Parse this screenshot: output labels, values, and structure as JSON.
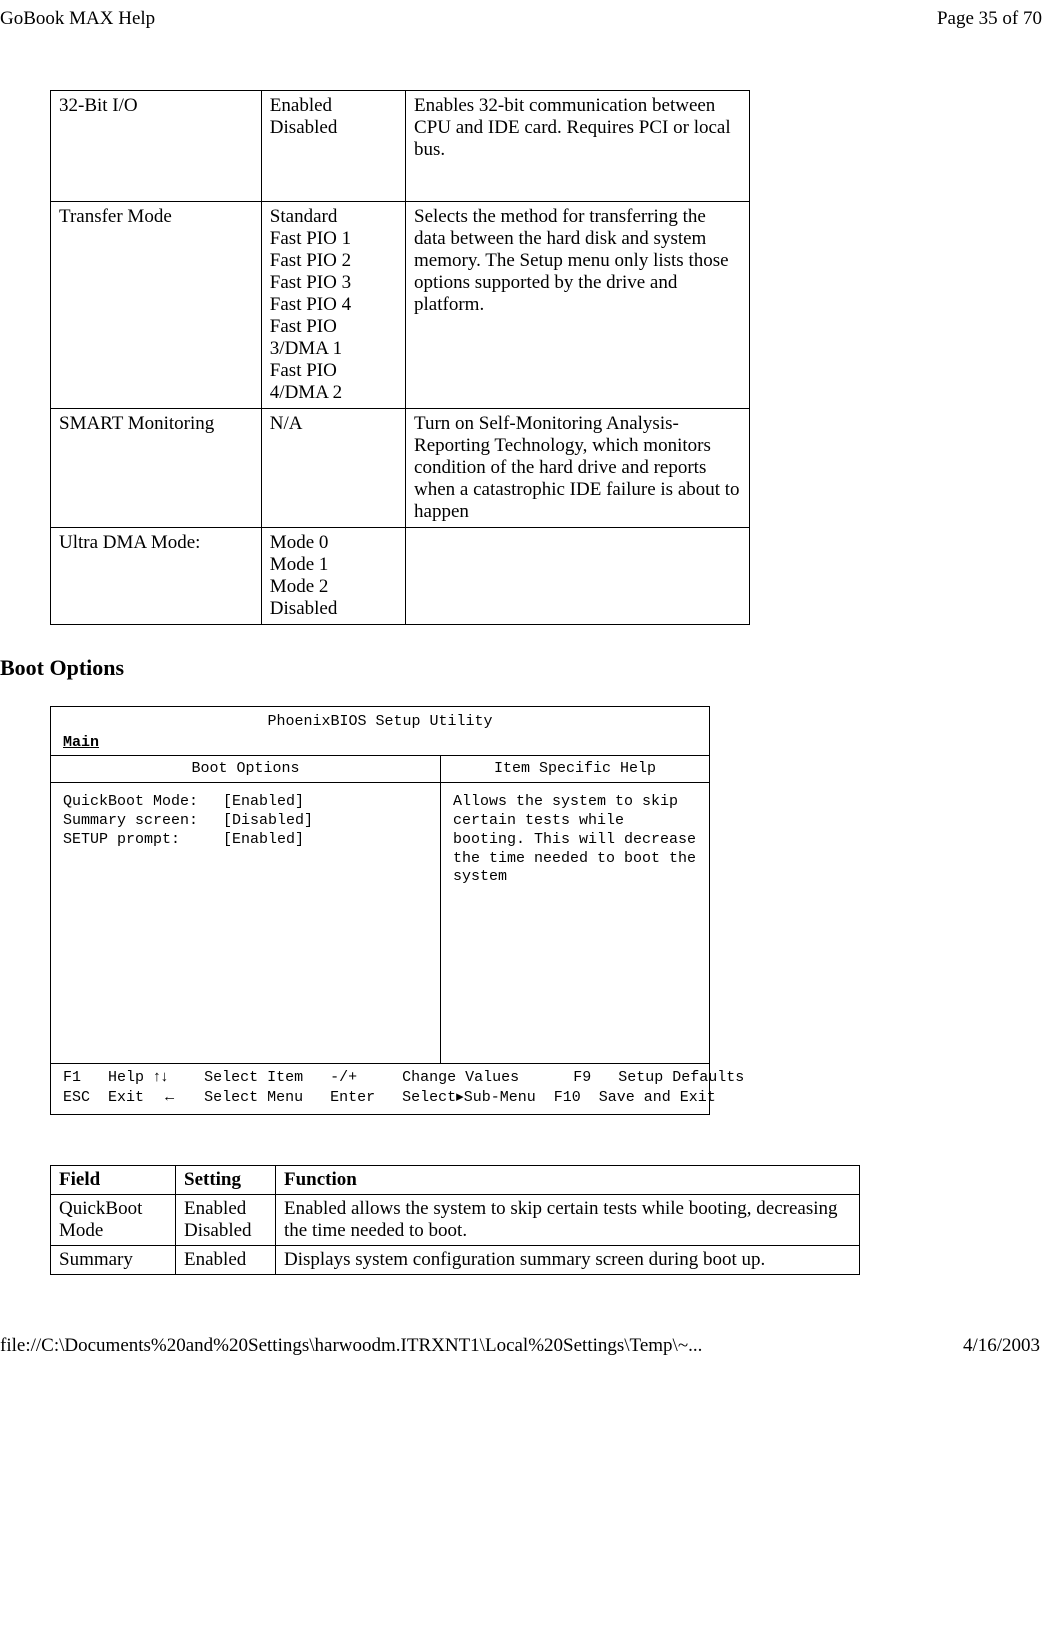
{
  "header": {
    "title": "GoBook MAX Help",
    "page": "Page 35 of 70"
  },
  "table1": {
    "rows": [
      {
        "field": "32-Bit I/O",
        "setting": "Enabled\nDisabled",
        "function": "Enables 32-bit communication between CPU and IDE card.  Requires PCI or local bus."
      },
      {
        "field": "Transfer Mode",
        "setting": "Standard\nFast PIO 1\nFast PIO 2\nFast PIO 3\nFast PIO 4\nFast PIO 3/DMA 1\nFast PIO 4/DMA 2",
        "function": "Selects the method for transferring the data between the hard disk and system memory. The Setup menu only lists those options supported by the drive and platform."
      },
      {
        "field": "SMART Monitoring",
        "setting": "N/A",
        "function": "Turn on Self-Monitoring Analysis-Reporting Technology, which monitors condition of the hard drive and reports when a catastrophic IDE failure is about to happen"
      },
      {
        "field": "Ultra DMA Mode:",
        "setting": "Mode 0\nMode 1\nMode 2\nDisabled",
        "function": ""
      }
    ]
  },
  "section": {
    "heading": "Boot Options"
  },
  "bios": {
    "title": "PhoenixBIOS Setup Utility",
    "main": "Main",
    "left_header": "Boot Options",
    "right_header": "Item Specific Help",
    "settings": [
      {
        "label": "QuickBoot Mode:",
        "value": "[Enabled]"
      },
      {
        "label": "Summary screen:",
        "value": "[Disabled]"
      },
      {
        "label": "SETUP prompt:",
        "value": "[Enabled]"
      }
    ],
    "help_text": "Allows the system to skip certain tests while booting.  This will decrease the time needed to boot the system",
    "footer_line1_a": "F1",
    "footer_line1_b": "Help",
    "footer_line1_c": "Select Item",
    "footer_line1_d": "-/+",
    "footer_line1_e": "Change Values",
    "footer_line1_f": "F9",
    "footer_line1_g": "Setup Defaults",
    "footer_line2_a": "ESC",
    "footer_line2_b": "Exit",
    "footer_line2_c": "Select Menu",
    "footer_line2_d": "Enter",
    "footer_line2_e": "Select",
    "footer_line2_f": "Sub-Menu",
    "footer_line2_g": "F10",
    "footer_line2_h": "Save and Exit"
  },
  "table2": {
    "headers": {
      "h1": "Field",
      "h2": "Setting",
      "h3": "Function"
    },
    "rows": [
      {
        "field": "QuickBoot Mode",
        "setting": "Enabled Disabled",
        "function": "Enabled allows the system to skip certain tests while booting, decreasing the time needed to boot."
      },
      {
        "field": "Summary",
        "setting": "Enabled",
        "function": "Displays system configuration summary screen during boot up."
      }
    ]
  },
  "footer": {
    "path": "file://C:\\Documents%20and%20Settings\\harwoodm.ITRXNT1\\Local%20Settings\\Temp\\~...",
    "date": "4/16/2003"
  }
}
